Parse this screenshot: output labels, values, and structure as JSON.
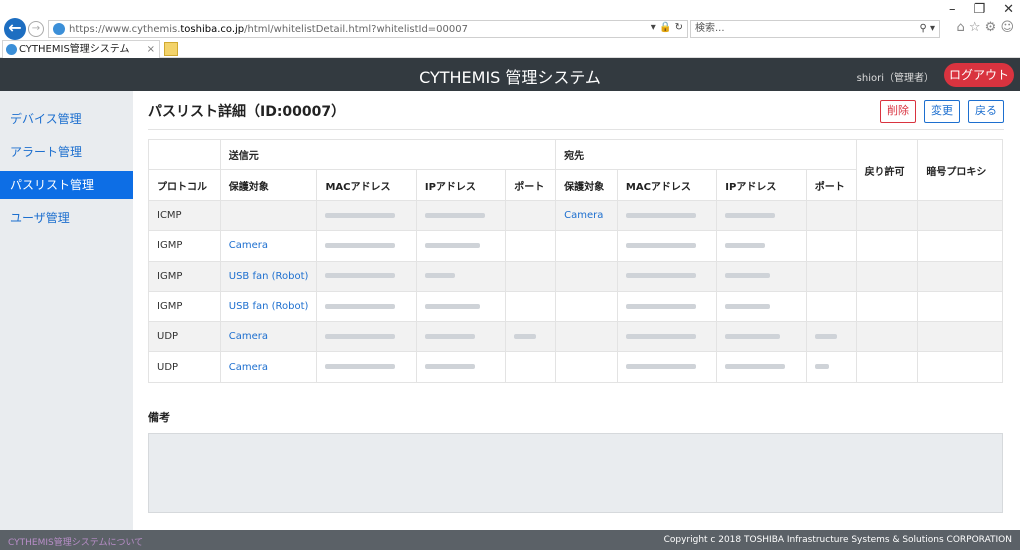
{
  "browser": {
    "url_prefix": "https://www.cythemis.",
    "url_domain": "toshiba.co.jp",
    "url_path": "/html/whitelistDetail.html?whitelistId=00007",
    "url_icons": "▾ 🔒 ↻",
    "search_placeholder": "検索...",
    "search_icon": "⚲ ▾",
    "toolbar_icons": "⌂ ☆ ⚙ ☺",
    "tab_label": "CYTHEMIS管理システム",
    "tab_close": "×",
    "min_icon": "–",
    "restore_icon": "❐",
    "close_icon": "✕",
    "back_icon": "←",
    "forward_icon": "→"
  },
  "header": {
    "title": "CYTHEMIS 管理システム",
    "user": "shiori（管理者）",
    "logout": "ログアウト"
  },
  "sidebar": {
    "items": [
      {
        "label": "デバイス管理",
        "active": false
      },
      {
        "label": "アラート管理",
        "active": false
      },
      {
        "label": "パスリスト管理",
        "active": true
      },
      {
        "label": "ユーザ管理",
        "active": false
      }
    ]
  },
  "main": {
    "title": "パスリスト詳細（ID:00007）",
    "buttons": {
      "delete": "削除",
      "edit": "変更",
      "back": "戻る"
    },
    "table": {
      "group_source": "送信元",
      "group_dest": "宛先",
      "col_protocol": "プロトコル",
      "col_target": "保護対象",
      "col_mac": "MACアドレス",
      "col_ip": "IPアドレス",
      "col_port": "ポート",
      "col_return": "戻り許可",
      "col_proxy": "暗号プロキシ",
      "rows": [
        {
          "protocol": "ICMP",
          "src_target": "",
          "dst_target": "Camera"
        },
        {
          "protocol": "IGMP",
          "src_target": "Camera",
          "dst_target": ""
        },
        {
          "protocol": "IGMP",
          "src_target": "USB fan (Robot)",
          "dst_target": ""
        },
        {
          "protocol": "IGMP",
          "src_target": "USB fan (Robot)",
          "dst_target": ""
        },
        {
          "protocol": "UDP",
          "src_target": "Camera",
          "dst_target": ""
        },
        {
          "protocol": "UDP",
          "src_target": "Camera",
          "dst_target": ""
        }
      ]
    },
    "remarks_label": "備考"
  },
  "footer": {
    "about": "CYTHEMIS管理システムについて",
    "copyright": "Copyright c 2018 TOSHIBA Infrastructure Systems & Solutions CORPORATION"
  }
}
